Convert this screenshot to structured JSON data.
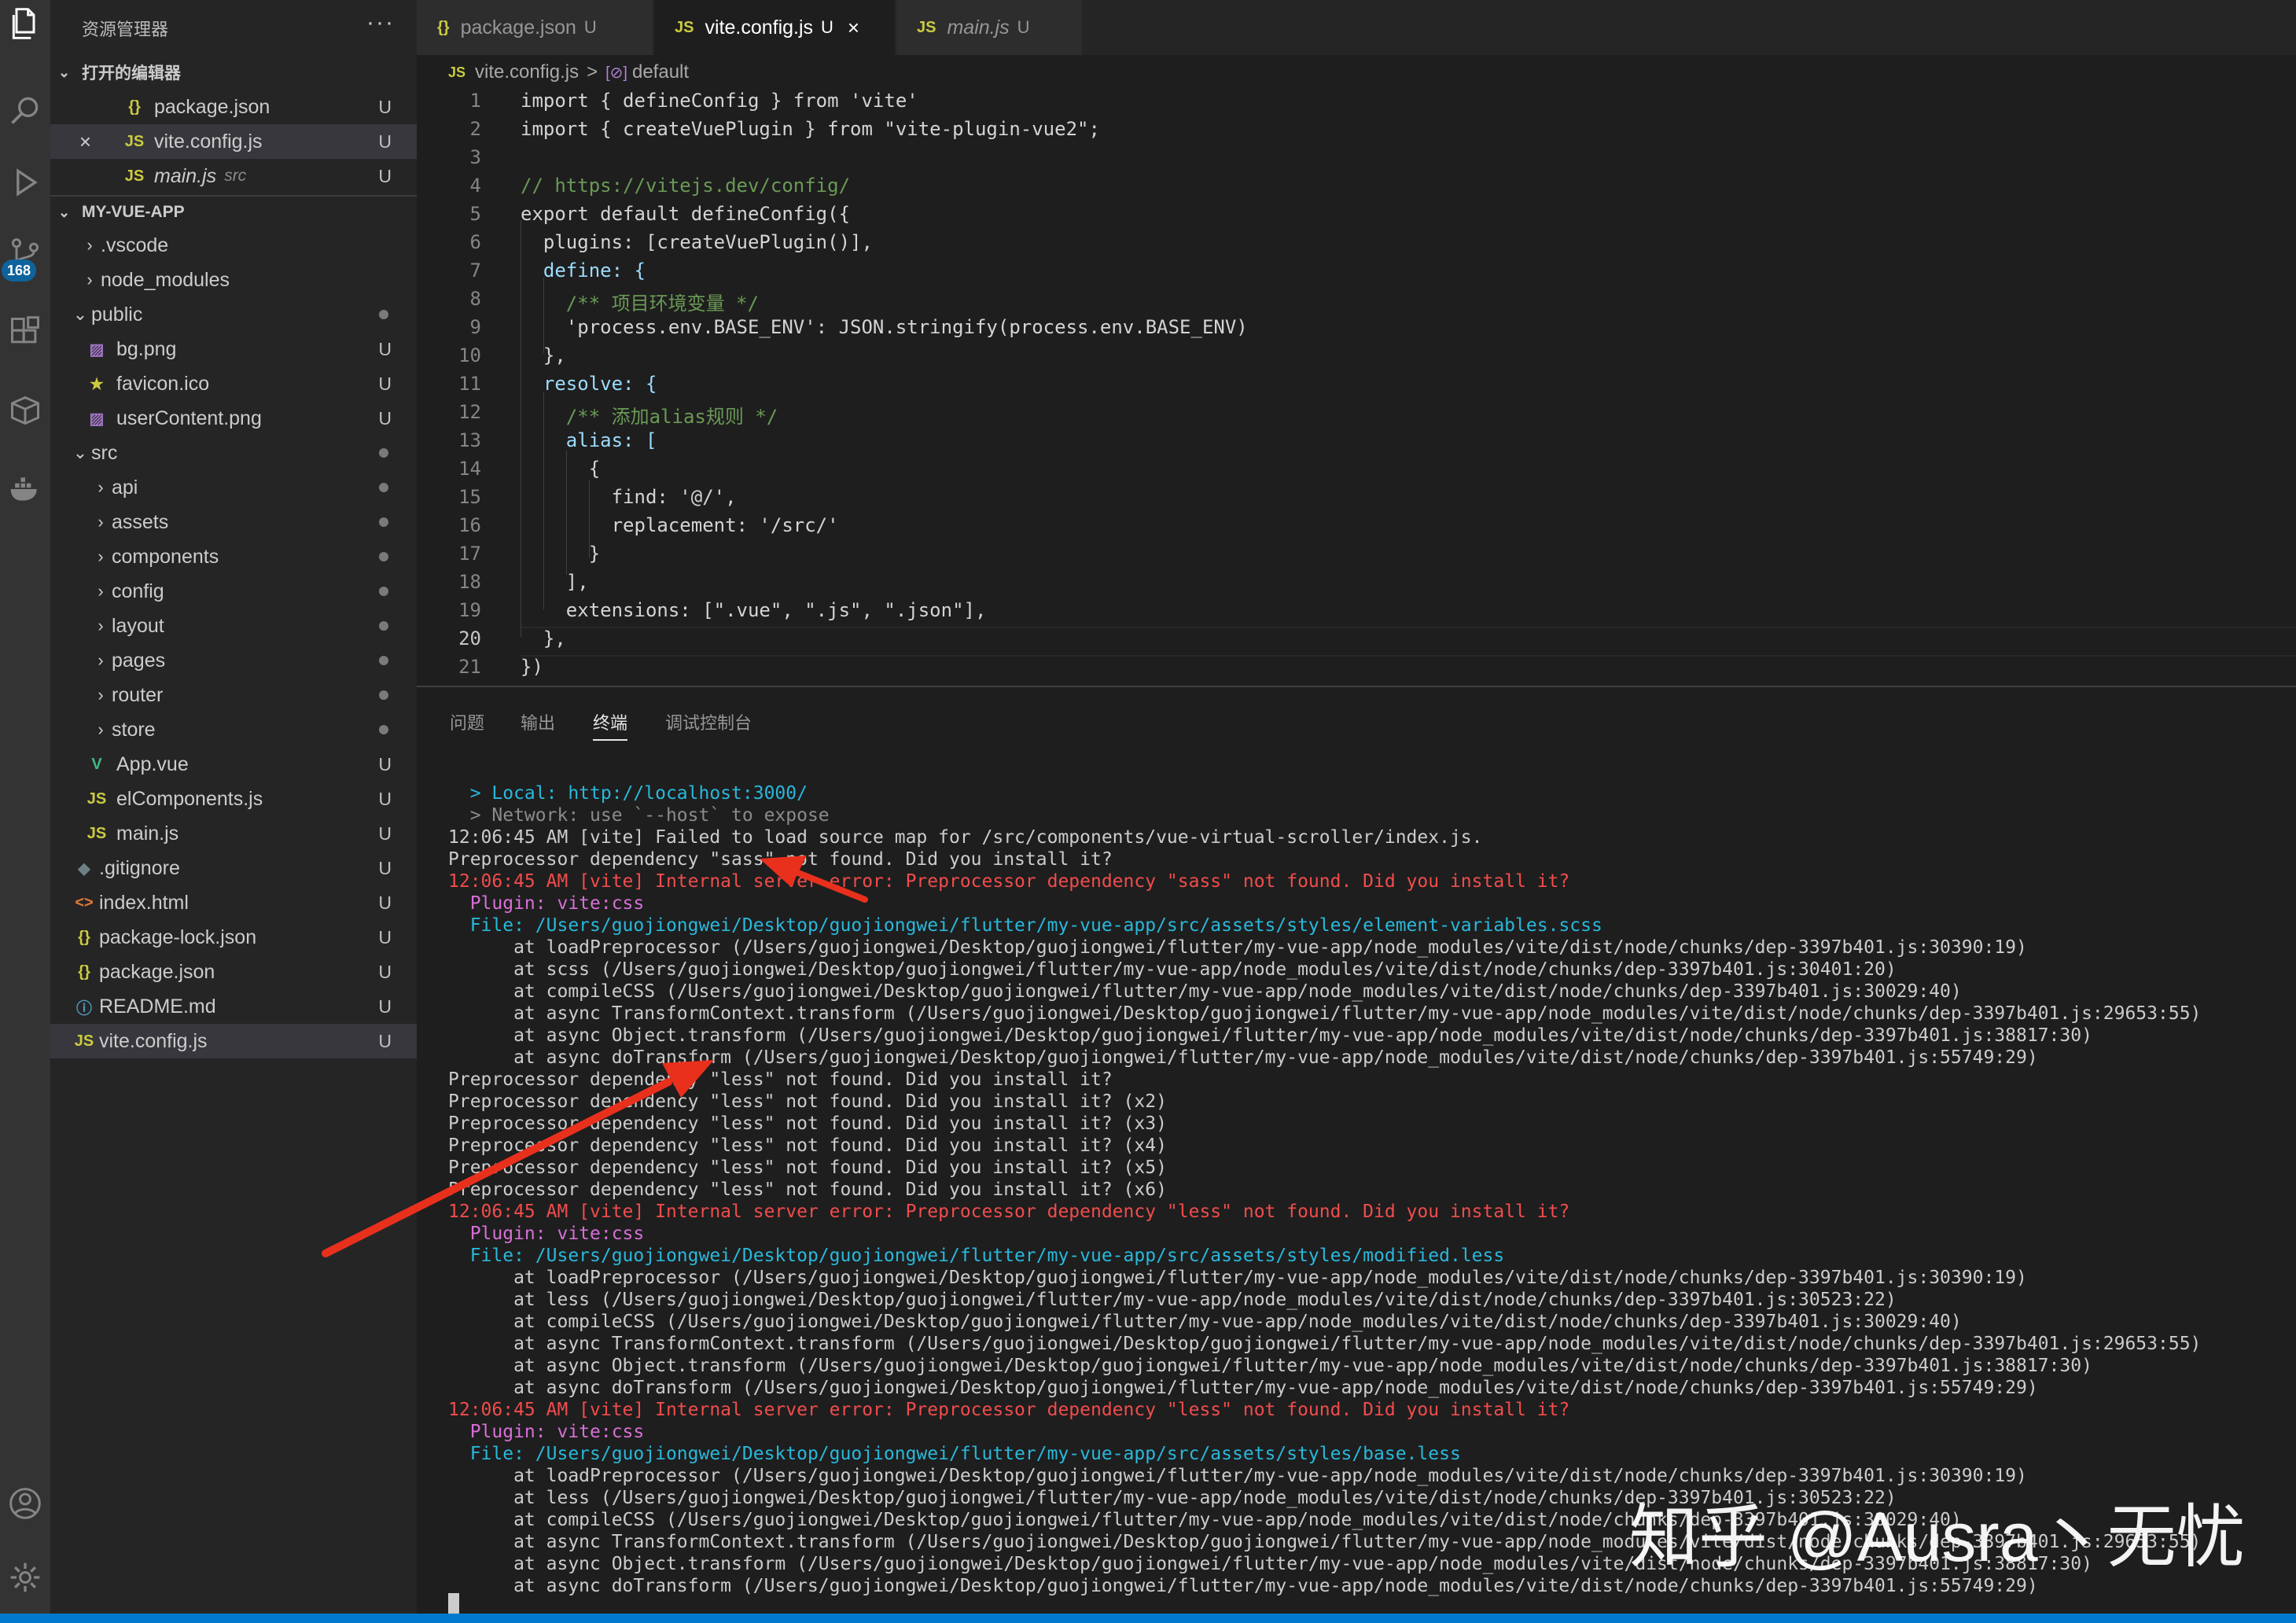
{
  "sidebar": {
    "title": "资源管理器",
    "more": "···",
    "open_editors": {
      "header": "打开的编辑器",
      "items": [
        {
          "icon": "{}",
          "name": "package.json",
          "desc": "",
          "status": "U"
        },
        {
          "icon": "JS",
          "name": "vite.config.js",
          "desc": "",
          "status": "U"
        },
        {
          "icon": "JS",
          "name": "main.js",
          "desc": "src",
          "status": "U"
        }
      ]
    },
    "project": {
      "header": "MY-VUE-APP",
      "items": [
        {
          "name": ".vscode"
        },
        {
          "name": "node_modules"
        },
        {
          "name": "public"
        },
        {
          "icon": "img",
          "name": "bg.png",
          "status": "U"
        },
        {
          "icon": "star",
          "name": "favicon.ico",
          "status": "U"
        },
        {
          "icon": "img",
          "name": "userContent.png",
          "status": "U"
        },
        {
          "name": "src"
        },
        {
          "name": "api"
        },
        {
          "name": "assets"
        },
        {
          "name": "components"
        },
        {
          "name": "config"
        },
        {
          "name": "layout"
        },
        {
          "name": "pages"
        },
        {
          "name": "router"
        },
        {
          "name": "store"
        },
        {
          "icon": "V",
          "name": "App.vue",
          "status": "U"
        },
        {
          "icon": "JS",
          "name": "elComponents.js",
          "status": "U"
        },
        {
          "icon": "JS",
          "name": "main.js",
          "status": "U"
        },
        {
          "icon": "◆",
          "name": ".gitignore",
          "status": "U"
        },
        {
          "icon": "<>",
          "name": "index.html",
          "status": "U"
        },
        {
          "icon": "{}",
          "name": "package-lock.json",
          "status": "U"
        },
        {
          "icon": "{}",
          "name": "package.json",
          "status": "U"
        },
        {
          "icon": "ⓘ",
          "name": "README.md",
          "status": "U"
        },
        {
          "icon": "JS",
          "name": "vite.config.js",
          "status": "U"
        }
      ]
    }
  },
  "activitybar": {
    "badge": "168"
  },
  "tabs": [
    {
      "icon": "{}",
      "name": "package.json",
      "status": "U",
      "active": false
    },
    {
      "icon": "JS",
      "name": "vite.config.js",
      "status": "U",
      "active": true,
      "close": "×"
    },
    {
      "icon": "JS",
      "name": "main.js",
      "status": "U",
      "active": false
    }
  ],
  "breadcrumb": {
    "icon": "JS",
    "file": "vite.config.js",
    "sep": ">",
    "symbol_icon": "[⊘]",
    "symbol": "default"
  },
  "editor": {
    "line_numbers": [
      "1",
      "2",
      "3",
      "4",
      "5",
      "6",
      "7",
      "8",
      "9",
      "10",
      "11",
      "12",
      "13",
      "14",
      "15",
      "16",
      "17",
      "18",
      "19",
      "20",
      "21"
    ],
    "current_line": "20",
    "lines": [
      "import { defineConfig } from 'vite'",
      "import { createVuePlugin } from \"vite-plugin-vue2\";",
      "",
      "// https://vitejs.dev/config/",
      "export default defineConfig({",
      "  plugins: [createVuePlugin()],",
      "  define: {",
      "    /** 项目环境变量 */",
      "    'process.env.BASE_ENV': JSON.stringify(process.env.BASE_ENV)",
      "  },",
      "  resolve: {",
      "    /** 添加alias规则 */",
      "    alias: [",
      "      {",
      "        find: '@/',",
      "        replacement: '/src/'",
      "      }",
      "    ],",
      "    extensions: [\".vue\", \".js\", \".json\"],",
      "  },",
      "})"
    ]
  },
  "panel": {
    "tabs": [
      "问题",
      "输出",
      "终端",
      "调试控制台"
    ],
    "active_tab": "终端",
    "terminal": [
      "  > Local: http://localhost:3000/",
      "  > Network: use `--host` to expose",
      "12:06:45 AM [vite] Failed to load source map for /src/components/vue-virtual-scroller/index.js.",
      "Preprocessor dependency \"sass\" not found. Did you install it?",
      "12:06:45 AM [vite] Internal server error: Preprocessor dependency \"sass\" not found. Did you install it?",
      "  Plugin: vite:css",
      "  File: /Users/guojiongwei/Desktop/guojiongwei/flutter/my-vue-app/src/assets/styles/element-variables.scss",
      "      at loadPreprocessor (/Users/guojiongwei/Desktop/guojiongwei/flutter/my-vue-app/node_modules/vite/dist/node/chunks/dep-3397b401.js:30390:19)",
      "      at scss (/Users/guojiongwei/Desktop/guojiongwei/flutter/my-vue-app/node_modules/vite/dist/node/chunks/dep-3397b401.js:30401:20)",
      "      at compileCSS (/Users/guojiongwei/Desktop/guojiongwei/flutter/my-vue-app/node_modules/vite/dist/node/chunks/dep-3397b401.js:30029:40)",
      "      at async TransformContext.transform (/Users/guojiongwei/Desktop/guojiongwei/flutter/my-vue-app/node_modules/vite/dist/node/chunks/dep-3397b401.js:29653:55)",
      "      at async Object.transform (/Users/guojiongwei/Desktop/guojiongwei/flutter/my-vue-app/node_modules/vite/dist/node/chunks/dep-3397b401.js:38817:30)",
      "      at async doTransform (/Users/guojiongwei/Desktop/guojiongwei/flutter/my-vue-app/node_modules/vite/dist/node/chunks/dep-3397b401.js:55749:29)",
      "Preprocessor dependency \"less\" not found. Did you install it?",
      "Preprocessor dependency \"less\" not found. Did you install it? (x2)",
      "Preprocessor dependency \"less\" not found. Did you install it? (x3)",
      "Preprocessor dependency \"less\" not found. Did you install it? (x4)",
      "Preprocessor dependency \"less\" not found. Did you install it? (x5)",
      "Preprocessor dependency \"less\" not found. Did you install it? (x6)",
      "12:06:45 AM [vite] Internal server error: Preprocessor dependency \"less\" not found. Did you install it?",
      "  Plugin: vite:css",
      "  File: /Users/guojiongwei/Desktop/guojiongwei/flutter/my-vue-app/src/assets/styles/modified.less",
      "      at loadPreprocessor (/Users/guojiongwei/Desktop/guojiongwei/flutter/my-vue-app/node_modules/vite/dist/node/chunks/dep-3397b401.js:30390:19)",
      "      at less (/Users/guojiongwei/Desktop/guojiongwei/flutter/my-vue-app/node_modules/vite/dist/node/chunks/dep-3397b401.js:30523:22)",
      "      at compileCSS (/Users/guojiongwei/Desktop/guojiongwei/flutter/my-vue-app/node_modules/vite/dist/node/chunks/dep-3397b401.js:30029:40)",
      "      at async TransformContext.transform (/Users/guojiongwei/Desktop/guojiongwei/flutter/my-vue-app/node_modules/vite/dist/node/chunks/dep-3397b401.js:29653:55)",
      "      at async Object.transform (/Users/guojiongwei/Desktop/guojiongwei/flutter/my-vue-app/node_modules/vite/dist/node/chunks/dep-3397b401.js:38817:30)",
      "      at async doTransform (/Users/guojiongwei/Desktop/guojiongwei/flutter/my-vue-app/node_modules/vite/dist/node/chunks/dep-3397b401.js:55749:29)",
      "12:06:45 AM [vite] Internal server error: Preprocessor dependency \"less\" not found. Did you install it?",
      "  Plugin: vite:css",
      "  File: /Users/guojiongwei/Desktop/guojiongwei/flutter/my-vue-app/src/assets/styles/base.less",
      "      at loadPreprocessor (/Users/guojiongwei/Desktop/guojiongwei/flutter/my-vue-app/node_modules/vite/dist/node/chunks/dep-3397b401.js:30390:19)",
      "      at less (/Users/guojiongwei/Desktop/guojiongwei/flutter/my-vue-app/node_modules/vite/dist/node/chunks/dep-3397b401.js:30523:22)",
      "      at compileCSS (/Users/guojiongwei/Desktop/guojiongwei/flutter/my-vue-app/node_modules/vite/dist/node/chunks/dep-3397b401.js:30029:40)",
      "      at async TransformContext.transform (/Users/guojiongwei/Desktop/guojiongwei/flutter/my-vue-app/node_modules/vite/dist/node/chunks/dep-3397b401.js:29653:55)",
      "      at async Object.transform (/Users/guojiongwei/Desktop/guojiongwei/flutter/my-vue-app/node_modules/vite/dist/node/chunks/dep-3397b401.js:38817:30)",
      "      at async doTransform (/Users/guojiongwei/Desktop/guojiongwei/flutter/my-vue-app/node_modules/vite/dist/node/chunks/dep-3397b401.js:55749:29)"
    ]
  },
  "watermark": "知乎 @Ausra丶无忧",
  "colors": {
    "accent": "#007acc",
    "arrow": "#e8301c",
    "error": "#f14c4c",
    "link": "#29b8db"
  }
}
